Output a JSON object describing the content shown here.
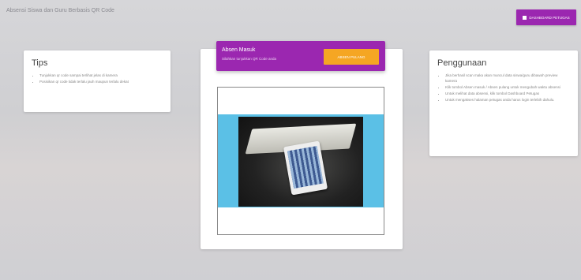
{
  "header": {
    "app_title": "Absensi Siswa dan Guru Berbasis QR Code",
    "dashboard_button_label": "DASHBOARD PETUGAS"
  },
  "tips": {
    "title": "Tips",
    "items": [
      "Tunjukkan qr code sampai terlihat jelas di kamera",
      "Posisikan qr code tidak terlalu jauh maupun terlalu dekat"
    ]
  },
  "attendance": {
    "title": "Absen Masuk",
    "subtitle": "Silahkan tunjukkan QR Code anda",
    "return_button_label": "ABSEN PULANG"
  },
  "usage": {
    "title": "Penggunaan",
    "items": [
      "Jika berhasil scan maka akan muncul data siswa/guru dibawah preview kamera",
      "Klik tombol Absen masuk / Absen pulang untuk mengubah waktu absensi",
      "Untuk melihat data absensi, klik tombol Dashboard Petugas",
      "Untuk mengakses halaman petugas anda harus login terlebih dahulu."
    ]
  },
  "colors": {
    "accent": "#9b27b0",
    "button": "#f5a623",
    "camera_bg": "#5bc0e6"
  }
}
